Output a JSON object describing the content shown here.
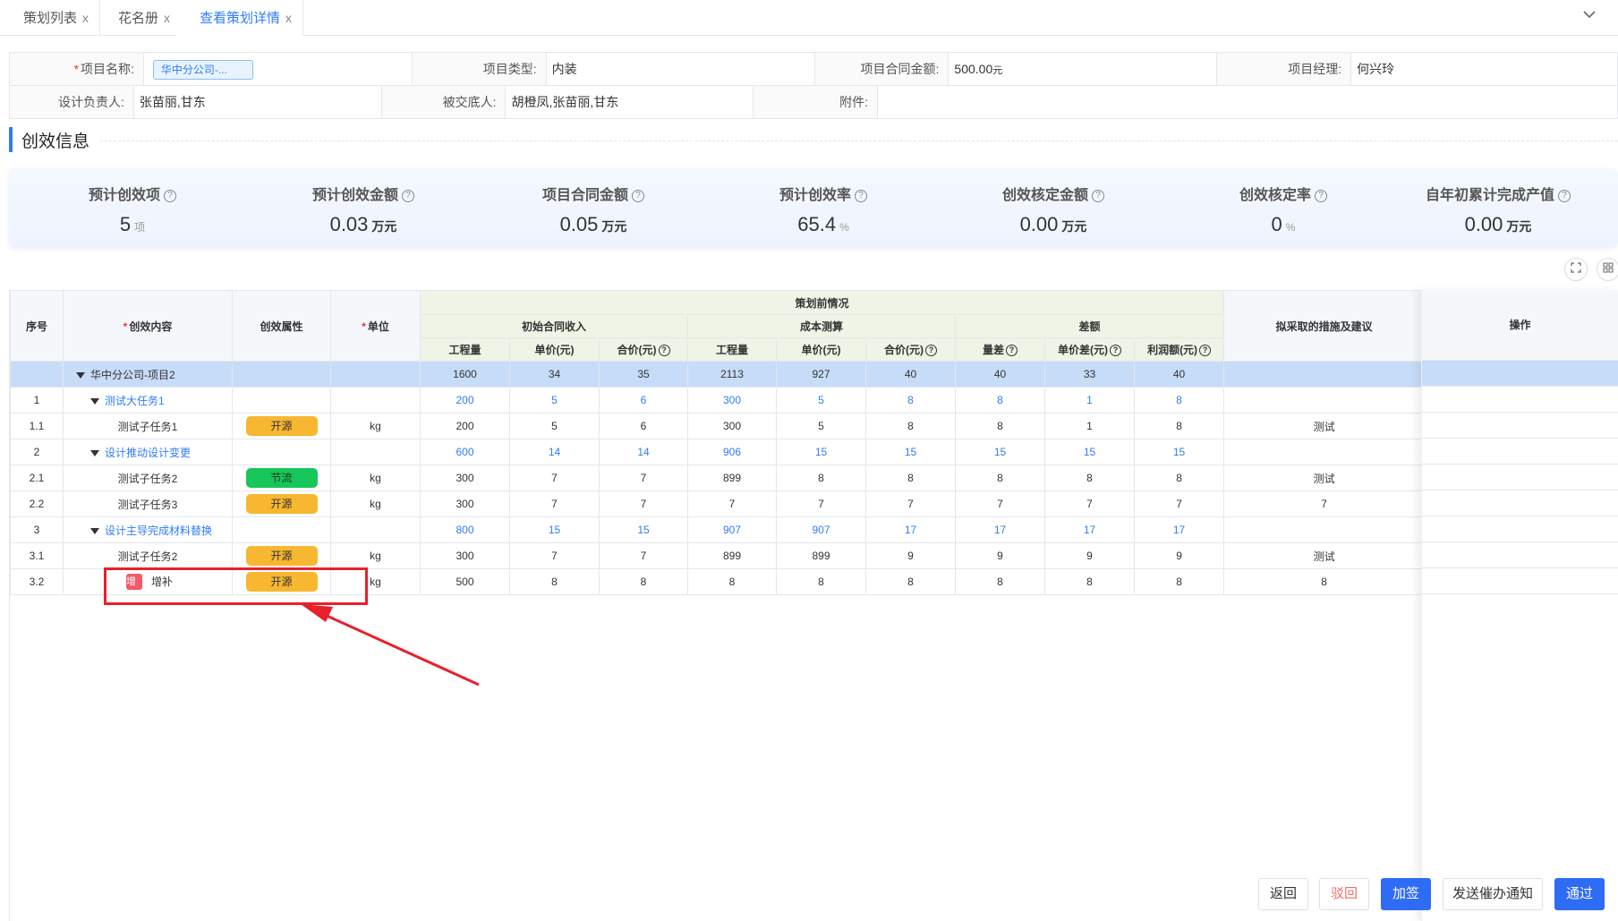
{
  "tabs": [
    {
      "label": "策划列表",
      "active": false
    },
    {
      "label": "花名册",
      "active": false
    },
    {
      "label": "查看策划详情",
      "active": true
    }
  ],
  "tab_close": "x",
  "tab_dropdown_icon": "chevron-down-icon",
  "info": {
    "project_name_label": "项目名称:",
    "project_name_value": "华中分公司-...",
    "project_type_label": "项目类型:",
    "project_type_value": "内装",
    "contract_amount_label": "项目合同金额:",
    "contract_amount_value": "500.00",
    "contract_amount_unit": "元",
    "manager_label": "项目经理:",
    "manager_value": "何兴玲",
    "designer_label": "设计负责人:",
    "designer_value": "张苗丽,甘东",
    "handover_label": "被交底人:",
    "handover_value": "胡橙凤,张苗丽,甘东",
    "attachment_label": "附件:",
    "attachment_value": ""
  },
  "section_title": "创效信息",
  "stats": [
    {
      "label": "预计创效项",
      "value": "5",
      "unit": "项",
      "unit_bold": false
    },
    {
      "label": "预计创效金额",
      "value": "0.03",
      "unit": "万元",
      "unit_bold": true
    },
    {
      "label": "项目合同金额",
      "value": "0.05",
      "unit": "万元",
      "unit_bold": true
    },
    {
      "label": "预计创效率",
      "value": "65.4",
      "unit": "%",
      "unit_bold": false
    },
    {
      "label": "创效核定金额",
      "value": "0.00",
      "unit": "万元",
      "unit_bold": true
    },
    {
      "label": "创效核定率",
      "value": "0",
      "unit": "%",
      "unit_bold": false
    },
    {
      "label": "自年初累计完成产值",
      "value": "0.00",
      "unit": "万元",
      "unit_bold": true
    }
  ],
  "toolbar_icons": [
    "fullscreen-icon",
    "grid-icon"
  ],
  "table": {
    "headers": {
      "seq": "序号",
      "content": "创效内容",
      "attr": "创效属性",
      "unit": "单位",
      "pre_plan": "策划前情况",
      "initial_income": "初始合同收入",
      "cost_estimate": "成本测算",
      "difference": "差额",
      "measures": "拟采取的措施及建议",
      "qty": "工程量",
      "unit_price": "单价(元)",
      "total_price": "合价(元)",
      "qty2": "工程量",
      "unit_price2": "单价(元)",
      "total_price2": "合价(元)",
      "qty_diff": "量差",
      "price_diff": "单价差(元)",
      "profit": "利润额(元)"
    },
    "rows": [
      {
        "seq": "",
        "content": "华中分公司-项目2",
        "level": "top",
        "attr": "",
        "attr_color": "",
        "unit": "",
        "vals": [
          "1600",
          "34",
          "35",
          "2113",
          "927",
          "40",
          "40",
          "33",
          "40"
        ],
        "measures": ""
      },
      {
        "seq": "1",
        "content": "测试大任务1",
        "level": "parent",
        "attr": "",
        "attr_color": "",
        "unit": "",
        "vals": [
          "200",
          "5",
          "6",
          "300",
          "5",
          "8",
          "8",
          "1",
          "8"
        ],
        "measures": ""
      },
      {
        "seq": "1.1",
        "content": "测试子任务1",
        "level": "child",
        "attr": "开源",
        "attr_color": "orange",
        "unit": "kg",
        "vals": [
          "200",
          "5",
          "6",
          "300",
          "5",
          "8",
          "8",
          "1",
          "8"
        ],
        "measures": "测试"
      },
      {
        "seq": "2",
        "content": "设计推动设计变更",
        "level": "parent",
        "attr": "",
        "attr_color": "",
        "unit": "",
        "vals": [
          "600",
          "14",
          "14",
          "906",
          "15",
          "15",
          "15",
          "15",
          "15"
        ],
        "measures": ""
      },
      {
        "seq": "2.1",
        "content": "测试子任务2",
        "level": "child",
        "attr": "节流",
        "attr_color": "green",
        "unit": "kg",
        "vals": [
          "300",
          "7",
          "7",
          "899",
          "8",
          "8",
          "8",
          "8",
          "8"
        ],
        "measures": "测试"
      },
      {
        "seq": "2.2",
        "content": "测试子任务3",
        "level": "child",
        "attr": "开源",
        "attr_color": "orange",
        "unit": "kg",
        "vals": [
          "300",
          "7",
          "7",
          "7",
          "7",
          "7",
          "7",
          "7",
          "7"
        ],
        "measures": "7"
      },
      {
        "seq": "3",
        "content": "设计主导完成材料替换",
        "level": "parent",
        "attr": "",
        "attr_color": "",
        "unit": "",
        "vals": [
          "800",
          "15",
          "15",
          "907",
          "907",
          "17",
          "17",
          "17",
          "17"
        ],
        "measures": ""
      },
      {
        "seq": "3.1",
        "content": "测试子任务2",
        "level": "child",
        "attr": "开源",
        "attr_color": "orange",
        "unit": "kg",
        "vals": [
          "300",
          "7",
          "7",
          "899",
          "899",
          "9",
          "9",
          "9",
          "9"
        ],
        "measures": "测试"
      },
      {
        "seq": "3.2",
        "content": "增补",
        "badge": "增",
        "level": "child-added",
        "attr": "开源",
        "attr_color": "orange",
        "unit": "kg",
        "vals": [
          "500",
          "8",
          "8",
          "8",
          "8",
          "8",
          "8",
          "8",
          "8"
        ],
        "measures": "8"
      }
    ],
    "op_header": "操作"
  },
  "buttons": {
    "back": "返回",
    "reject": "驳回",
    "add_sign": "加签",
    "notify": "发送催办通知",
    "approve": "通过"
  },
  "colors": {
    "primary": "#2f6cf6",
    "open_source_tag": "#f7b731",
    "cut_cost_tag": "#17c65a",
    "annotation": "#e8202a"
  }
}
